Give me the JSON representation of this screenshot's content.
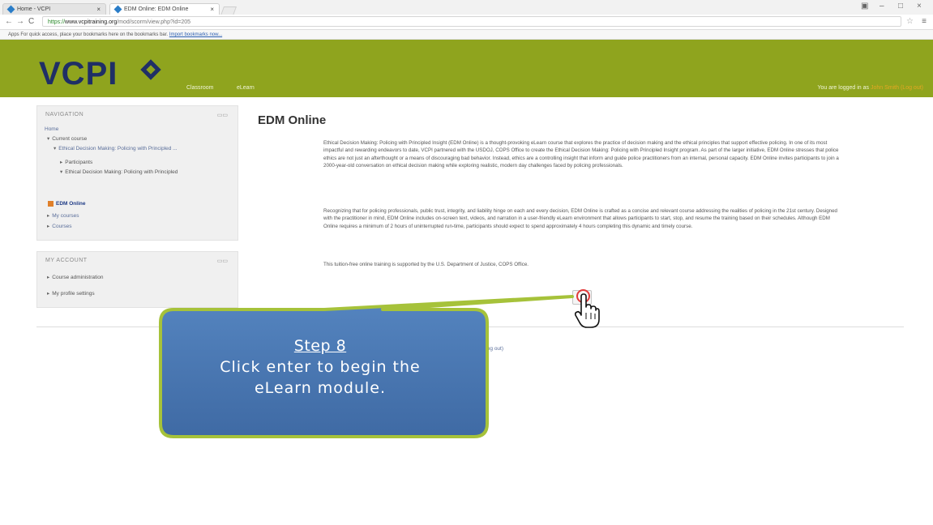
{
  "browser": {
    "tabs": [
      {
        "label": "Home - VCPI"
      },
      {
        "label": "EDM Online: EDM Online"
      }
    ],
    "url_scheme": "https://",
    "url_host": "www.vcpitraining.org",
    "url_path": "/mod/scorm/view.php?id=205",
    "bookmarks_text": "Apps  For quick access, place your bookmarks here on the bookmarks bar.",
    "bookmarks_link": "Import bookmarks now..."
  },
  "site": {
    "logo": "VCPI",
    "nav_items": [
      "Classroom",
      "eLearn"
    ],
    "logged_in_prefix": "You are logged in as",
    "user": "John Smith",
    "logout": "(Log out)"
  },
  "navigation": {
    "title": "NAVIGATION",
    "home": "Home",
    "current_course": "Current course",
    "course_name": "Ethical Decision Making: Policing with Principled ...",
    "participants": "Participants",
    "section": "Ethical Decision Making: Policing with Principled",
    "active": "EDM Online",
    "my_courses": "My courses",
    "courses": "Courses"
  },
  "my_account": {
    "title": "MY ACCOUNT",
    "course_admin": "Course administration",
    "profile": "My profile settings"
  },
  "main": {
    "title": "EDM Online",
    "para1": "Ethical Decision Making: Policing with Principled Insight (EDM Online) is a thought-provoking eLearn course that explores the practice of decision making and the ethical principles that support effective policing. In one of its most impactful and rewarding endeavors to date, VCPI partnered with the USDOJ, COPS Office to create the Ethical Decision Making: Policing with Principled Insight program. As part of the larger initiative, EDM Online stresses that police ethics are not just an afterthought or a means of discouraging bad behavior. Instead, ethics are a controlling insight that inform and guide police practitioners from an internal, personal capacity. EDM Online invites participants to join a 2000-year-old conversation on ethical decision making while exploring realistic, modern day challenges faced by policing professionals.",
    "para2": "Recognizing that for policing professionals, public trust, integrity, and liability hinge on each and every decision, EDM Online is crafted as a concise and relevant course addressing the realities of policing in the 21st century. Designed with the practitioner in mind, EDM Online includes on-screen text, videos, and narration in a user-friendly eLearn environment that allows participants to start, stop, and resume the training based on their schedules. Although EDM Online requires a minimum of 2 hours of uninterrupted run-time, participants should expect to spend approximately 4 hours completing this dynamic and timely course.",
    "para3": "This tuition-free online training is supported by the U.S. Department of Justice, COPS Office.",
    "footer_link": "(Log out)"
  },
  "callout": {
    "step": "Step 8",
    "line1": "Click enter to begin the",
    "line2": "eLearn module."
  },
  "colors": {
    "header_green": "#8fa41e",
    "logo_navy": "#1f2f66",
    "callout_blue": "#4a76b0"
  }
}
